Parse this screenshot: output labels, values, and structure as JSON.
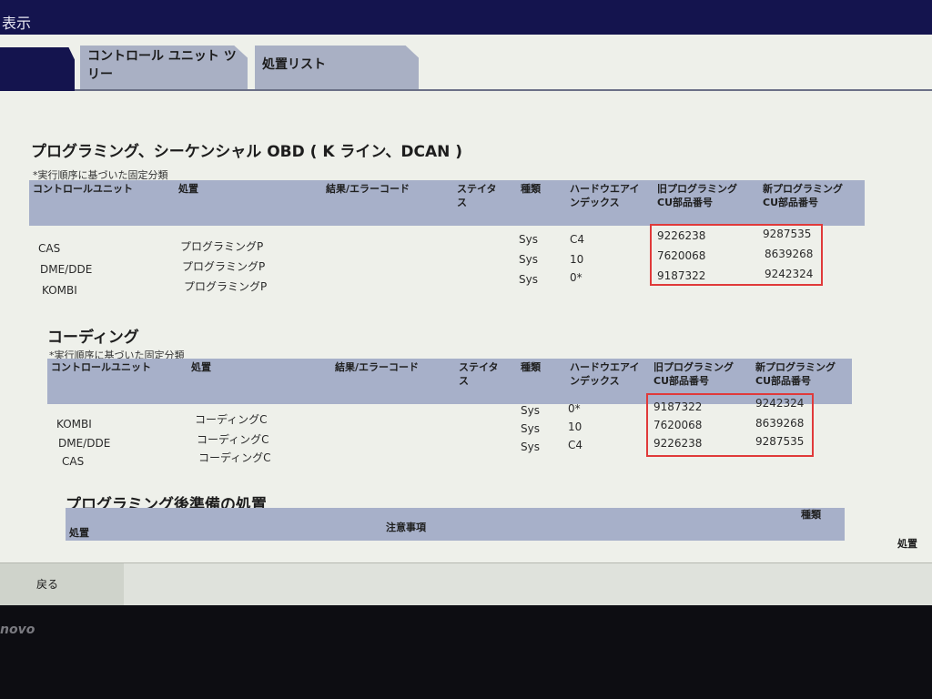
{
  "window": {
    "title": "表示"
  },
  "tabs": [
    {
      "label": ""
    },
    {
      "label": "コントロール ユニット ツリー"
    },
    {
      "label": "処置リスト"
    }
  ],
  "programming": {
    "title": "プログラミング、シーケンシャル OBD ( K ライン、DCAN )",
    "note": "*実行順序に基づいた固定分類",
    "headers": [
      "コントロールユニット",
      "処置",
      "結果/エラーコード",
      "ステイタス",
      "種類",
      "ハードウエアインデックス",
      "旧プログラミングCU部品番号",
      "新プログラミングCU部品番号"
    ],
    "rows": [
      {
        "unit": "CAS",
        "action": "プログラミングP",
        "kind": "Sys",
        "hw": "C4",
        "old": "9226238",
        "new": "9287535"
      },
      {
        "unit": "DME/DDE",
        "action": "プログラミングP",
        "kind": "Sys",
        "hw": "10",
        "old": "7620068",
        "new": "8639268"
      },
      {
        "unit": "KOMBI",
        "action": "プログラミングP",
        "kind": "Sys",
        "hw": "0*",
        "old": "9187322",
        "new": "9242324"
      }
    ]
  },
  "coding": {
    "title": "コーディング",
    "note": "*実行順序に基づいた固定分類",
    "headers": [
      "コントロールユニット",
      "処置",
      "結果/エラーコード",
      "ステイタス",
      "種類",
      "ハードウエアインデックス",
      "旧プログラミングCU部品番号",
      "新プログラミングCU部品番号"
    ],
    "rows": [
      {
        "unit": "KOMBI",
        "action": "コーディングC",
        "kind": "Sys",
        "hw": "0*",
        "old": "9187322",
        "new": "9242324"
      },
      {
        "unit": "DME/DDE",
        "action": "コーディングC",
        "kind": "Sys",
        "hw": "10",
        "old": "7620068",
        "new": "8639268"
      },
      {
        "unit": "CAS",
        "action": "コーディングC",
        "kind": "Sys",
        "hw": "C4",
        "old": "9226238",
        "new": "9287535"
      }
    ]
  },
  "post": {
    "title": "プログラミング後準備の処置",
    "headers": [
      "処置",
      "注意事項",
      "種類"
    ],
    "right_label": "処置"
  },
  "footer": {
    "back_label": "戻る"
  },
  "bezel": {
    "brand": "novo"
  },
  "colors": {
    "header_bg": "#a7b0c9",
    "title_bar": "#14144e",
    "highlight": "#e03a3a"
  }
}
